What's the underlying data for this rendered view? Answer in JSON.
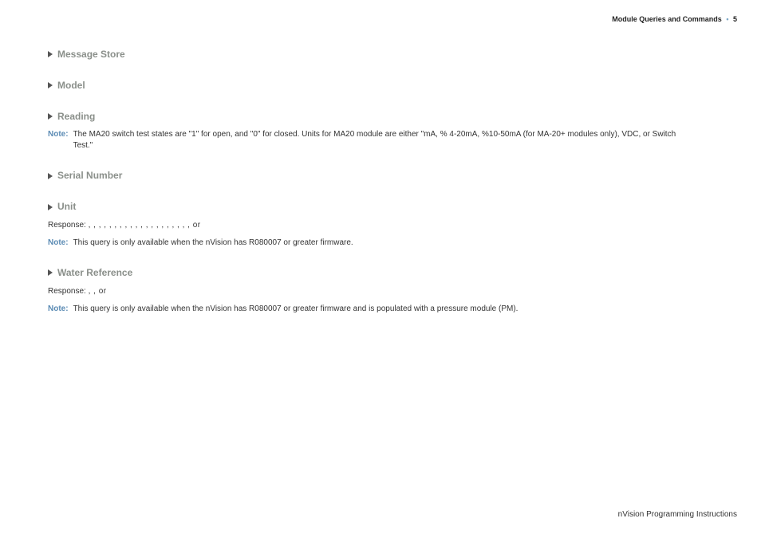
{
  "header": {
    "section_title": "Module Queries and Commands",
    "page_number": "5"
  },
  "sections": [
    {
      "id": "message-store",
      "title": "Message Store"
    },
    {
      "id": "model",
      "title": "Model"
    },
    {
      "id": "reading",
      "title": "Reading",
      "note": "The MA20 switch test states are \"1\" for open, and \"0\" for closed. Units for MA20 module are either \"mA, % 4-20mA, %10-50mA (for MA-20+ modules only), VDC, or Switch Test.\""
    },
    {
      "id": "serial-number",
      "title": "Serial Number"
    },
    {
      "id": "unit",
      "title": "Unit",
      "response_label": "Response:",
      "response_body": "      ,            ,       ,         ,       ,          ,     ,       ,       ,     ,         ,   ,   ,   ,   ,       ,         ,          ,                  ,       , or",
      "note": "This query is only available when the nVision has R080007 or greater firmware."
    },
    {
      "id": "water-reference",
      "title": "Water Reference",
      "response_label": "Response:",
      "response_body": "     ,        , or",
      "note": "This query is only available when the nVision has R080007 or greater firmware and is populated with a pressure module (PM)."
    }
  ],
  "labels": {
    "note": "Note:"
  },
  "footer": {
    "text": "nVision Programming Instructions"
  }
}
